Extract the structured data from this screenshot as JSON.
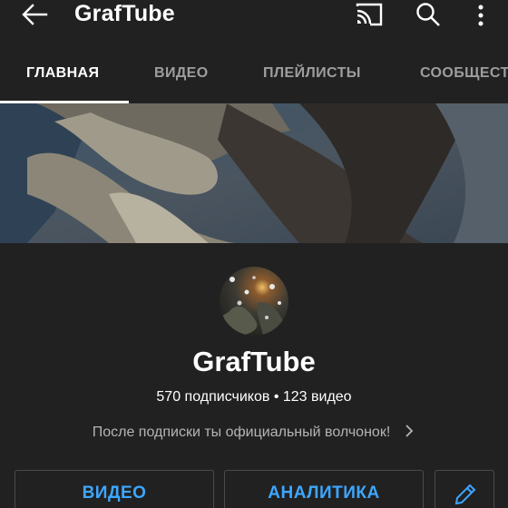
{
  "app_bar": {
    "title": "GrafTube",
    "icons": [
      "back-arrow-icon",
      "cast-icon",
      "search-icon",
      "more-vertical-icon"
    ]
  },
  "tabs": [
    {
      "label": "ГЛАВНАЯ",
      "active": true
    },
    {
      "label": "ВИДЕО",
      "active": false
    },
    {
      "label": "ПЛЕЙЛИСТЫ",
      "active": false
    },
    {
      "label": "СООБЩЕСТВО",
      "active": false
    }
  ],
  "channel": {
    "name": "GrafTube",
    "stats": "570 подписчиков • 123 видео",
    "description": "После подписки ты официальный волчонок!"
  },
  "actions": {
    "video_label": "ВИДЕО",
    "analytics_label": "АНАЛИТИКА",
    "edit_icon": "pencil-icon"
  },
  "colors": {
    "background": "#212121",
    "accent": "#3ea6ff",
    "tab_inactive": "#9e9e9e"
  }
}
